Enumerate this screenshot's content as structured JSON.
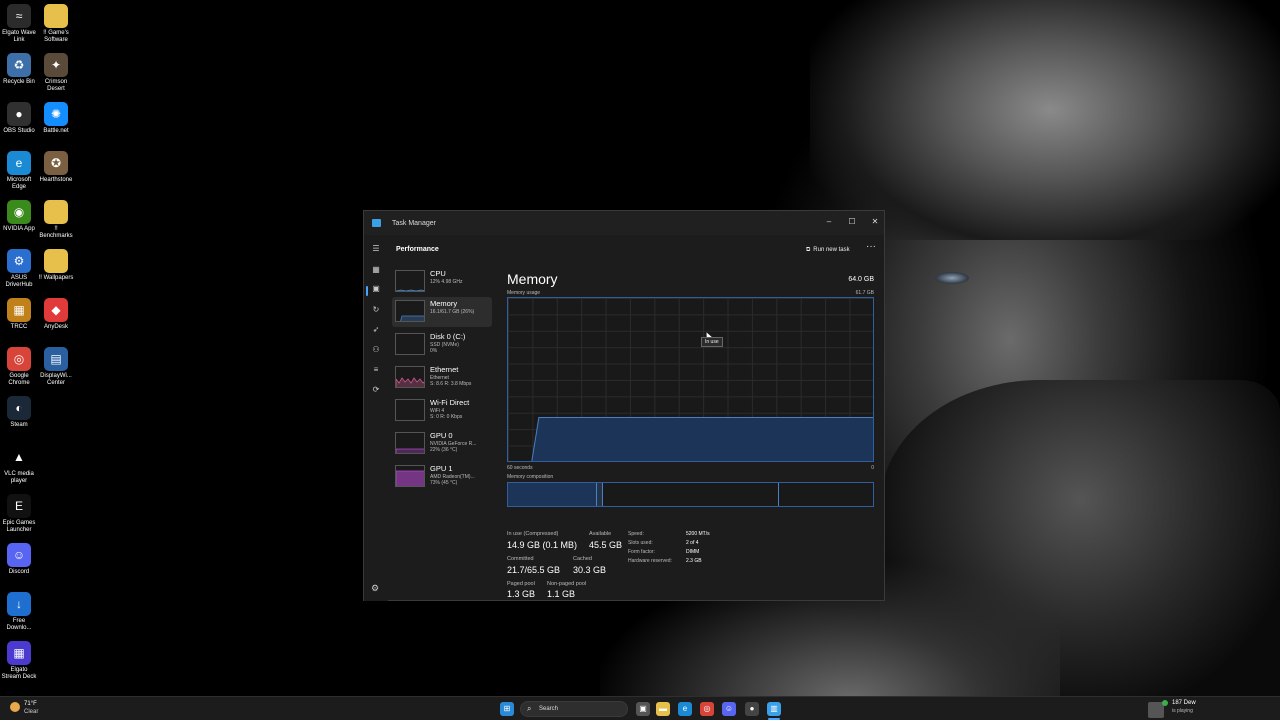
{
  "desktop_icons": [
    {
      "label": "Elgato Wave Link",
      "icon": "elgato-wave-icon",
      "color": "#2b2b2b",
      "glyph": "≈"
    },
    {
      "label": "!! Game's Software",
      "icon": "folder-icon",
      "color": "#e6c04a",
      "glyph": ""
    },
    {
      "label": "Recycle Bin",
      "icon": "recycle-bin-icon",
      "color": "#3d6fa8",
      "glyph": "♻"
    },
    {
      "label": "Crimson Desert",
      "icon": "crimson-desert-icon",
      "color": "#5a4a3a",
      "glyph": "✦"
    },
    {
      "label": "OBS Studio",
      "icon": "obs-icon",
      "color": "#303030",
      "glyph": "●"
    },
    {
      "label": "Battle.net",
      "icon": "battlenet-icon",
      "color": "#148eff",
      "glyph": "✺"
    },
    {
      "label": "Microsoft Edge",
      "icon": "edge-icon",
      "color": "#1a8ad4",
      "glyph": "e"
    },
    {
      "label": "Hearthstone",
      "icon": "hearthstone-icon",
      "color": "#7a6040",
      "glyph": "✪"
    },
    {
      "label": "NVIDIA App",
      "icon": "nvidia-icon",
      "color": "#3a8a1c",
      "glyph": "◉"
    },
    {
      "label": "!! Benchmarks",
      "icon": "folder-icon",
      "color": "#e6c04a",
      "glyph": ""
    },
    {
      "label": "ASUS DriverHub",
      "icon": "asus-icon",
      "color": "#2a6fd0",
      "glyph": "⚙"
    },
    {
      "label": "!! Wallpapers",
      "icon": "folder-icon",
      "color": "#e6c04a",
      "glyph": ""
    },
    {
      "label": "TRCC",
      "icon": "trcc-icon",
      "color": "#c0801a",
      "glyph": "▦"
    },
    {
      "label": "AnyDesk",
      "icon": "anydesk-icon",
      "color": "#e03a3a",
      "glyph": "◆"
    },
    {
      "label": "Google Chrome",
      "icon": "chrome-icon",
      "color": "#d9443a",
      "glyph": "◎"
    },
    {
      "label": "DisplayWi... Center",
      "icon": "display-center-icon",
      "color": "#2a5fa0",
      "glyph": "▤"
    },
    {
      "label": "Steam",
      "icon": "steam-icon",
      "color": "#1b2838",
      "glyph": "◐"
    },
    {
      "label": "VLC media player",
      "icon": "vlc-icon",
      "color": "#000000",
      "glyph": "▲"
    },
    {
      "label": "Epic Games Launcher",
      "icon": "epic-icon",
      "color": "#111111",
      "glyph": "E"
    },
    {
      "label": "Discord",
      "icon": "discord-icon",
      "color": "#5865f2",
      "glyph": "☺"
    },
    {
      "label": "Free Downlo...",
      "icon": "fdm-icon",
      "color": "#1f6fd0",
      "glyph": "↓"
    },
    {
      "label": "Elgato Stream Deck",
      "icon": "stream-deck-icon",
      "color": "#4a3ad0",
      "glyph": "▦"
    }
  ],
  "task_manager": {
    "title": "Task Manager",
    "section": "Performance",
    "run_new_task": "Run new task",
    "more": "···",
    "controls": {
      "minimize": "–",
      "maximize": "☐",
      "close": "✕"
    },
    "resources": [
      {
        "name": "CPU",
        "sub1": "12% 4.98 GHz",
        "sub2": "",
        "graph_color": "#3d8fd8",
        "active": false
      },
      {
        "name": "Memory",
        "sub1": "16.1/61.7 GB (26%)",
        "sub2": "",
        "graph_color": "#4a7fc1",
        "active": true
      },
      {
        "name": "Disk 0 (C:)",
        "sub1": "SSD (NVMe)",
        "sub2": "0%",
        "graph_color": "#3aa04a",
        "active": false
      },
      {
        "name": "Ethernet",
        "sub1": "Ethernet",
        "sub2": "S: 8.6 R: 3.8 Mbps",
        "graph_color": "#c85a8a",
        "active": false
      },
      {
        "name": "Wi-Fi Direct",
        "sub1": "WiFi 4",
        "sub2": "S: 0 R: 0 Kbps",
        "graph_color": "#c85a8a",
        "active": false
      },
      {
        "name": "GPU 0",
        "sub1": "NVIDIA GeForce R...",
        "sub2": "22% (36 °C)",
        "graph_color": "#b04ac8",
        "active": false
      },
      {
        "name": "GPU 1",
        "sub1": "AMD Radeon(TM)...",
        "sub2": "73% (45 °C)",
        "graph_color": "#b04ac8",
        "active": false
      }
    ],
    "memory": {
      "title": "Memory",
      "total": "64.0 GB",
      "usage_label": "Memory usage",
      "usage_max": "61.7 GB",
      "tooltip": "In use",
      "graph_left": "60 seconds",
      "graph_right": "0",
      "composition_label": "Memory composition",
      "stats": {
        "in_use_label": "In use (Compressed)",
        "in_use_value": "14.9 GB (0.1 MB)",
        "available_label": "Available",
        "available_value": "45.5 GB",
        "committed_label": "Committed",
        "committed_value": "21.7/65.5 GB",
        "cached_label": "Cached",
        "cached_value": "30.3 GB",
        "paged_label": "Paged pool",
        "paged_value": "1.3 GB",
        "nonpaged_label": "Non-paged pool",
        "nonpaged_value": "1.1 GB"
      },
      "specs": {
        "speed_label": "Speed:",
        "speed_value": "5200 MT/s",
        "slots_label": "Slots used:",
        "slots_value": "2 of 4",
        "form_label": "Form factor:",
        "form_value": "DIMM",
        "reserved_label": "Hardware reserved:",
        "reserved_value": "2.3 GB"
      }
    }
  },
  "taskbar": {
    "weather_temp": "71°F",
    "weather_desc": "Clear",
    "search_placeholder": "Search",
    "now_playing_name": "187 Dew",
    "now_playing_status": "is playing"
  },
  "colors": {
    "accent": "#4aa3ff",
    "memory_line": "#4a7fc1",
    "memory_fill": "#1b3458"
  }
}
